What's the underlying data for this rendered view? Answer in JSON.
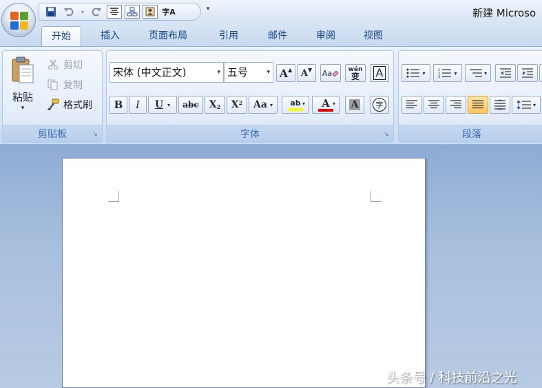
{
  "window": {
    "title": "新建 Microso"
  },
  "quick_access": {
    "buttons": [
      "save-icon",
      "undo-icon",
      "redo-icon",
      "align-icon",
      "org-chart-icon",
      "contact-icon",
      "spelling-icon"
    ],
    "spelling_glyph": "字A",
    "dropdown_glyph": "▾"
  },
  "tabs": [
    {
      "label": "开始",
      "active": true
    },
    {
      "label": "插入"
    },
    {
      "label": "页面布局"
    },
    {
      "label": "引用"
    },
    {
      "label": "邮件"
    },
    {
      "label": "审阅"
    },
    {
      "label": "视图"
    }
  ],
  "clipboard": {
    "paste_label": "粘贴",
    "cut_label": "剪切",
    "copy_label": "复制",
    "format_painter_label": "格式刷",
    "group_label": "剪贴板"
  },
  "font": {
    "font_name": "宋体 (中文正文)",
    "font_size": "五号",
    "grow_label": "A",
    "shrink_label": "A",
    "clear_format_label": "Aa",
    "phonetic_label": "wén",
    "phonetic_char": "变",
    "char_border_label": "A",
    "bold_label": "B",
    "italic_label": "I",
    "underline_label": "U",
    "strike_label": "abc",
    "subscript_label": "X",
    "subscript_mark": "2",
    "superscript_label": "X",
    "superscript_mark": "2",
    "change_case_label": "Aa",
    "highlight_label": "ab",
    "font_color_label": "A",
    "char_shading_label": "A",
    "enclose_label": "字",
    "group_label": "字体",
    "highlight_color": "#ffff00",
    "font_color": "#e00000"
  },
  "paragraph": {
    "group_label": "段落"
  },
  "watermark": "头条号 / 科技前沿之光"
}
